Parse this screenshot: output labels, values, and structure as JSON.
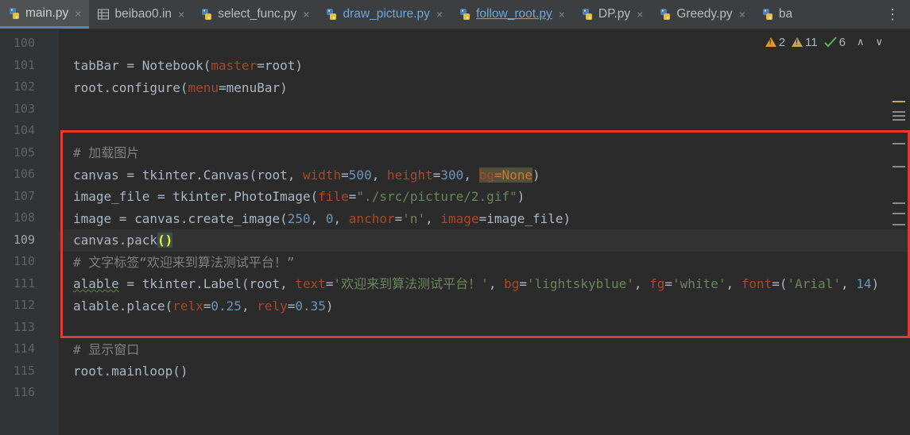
{
  "tabs": [
    {
      "label": "main.py",
      "icon": "python-file-icon",
      "active": true,
      "closable": true,
      "style": "normal"
    },
    {
      "label": "beibao0.in",
      "icon": "text-file-icon",
      "active": false,
      "closable": true,
      "style": "normal"
    },
    {
      "label": "select_func.py",
      "icon": "python-file-icon",
      "active": false,
      "closable": true,
      "style": "normal"
    },
    {
      "label": "draw_picture.py",
      "icon": "python-file-icon",
      "active": false,
      "closable": true,
      "style": "blue"
    },
    {
      "label": "follow_root.py",
      "icon": "python-file-icon",
      "active": false,
      "closable": true,
      "style": "blue-underline"
    },
    {
      "label": "DP.py",
      "icon": "python-file-icon",
      "active": false,
      "closable": true,
      "style": "normal"
    },
    {
      "label": "Greedy.py",
      "icon": "python-file-icon",
      "active": false,
      "closable": true,
      "style": "normal"
    },
    {
      "label": "ba",
      "icon": "python-file-icon",
      "active": false,
      "closable": false,
      "style": "normal"
    }
  ],
  "close_glyph": "×",
  "more_glyph": "⋮",
  "inspection": {
    "errors": "2",
    "warnings": "11",
    "ok": "6",
    "up_glyph": "∧",
    "down_glyph": "∨"
  },
  "line_numbers": [
    "100",
    "101",
    "102",
    "103",
    "104",
    "105",
    "106",
    "107",
    "108",
    "109",
    "110",
    "111",
    "112",
    "113",
    "114",
    "115",
    "116"
  ],
  "current_line": "109",
  "code": {
    "l101": {
      "a": "tabBar = Notebook(",
      "b": "master",
      "c": "=root)"
    },
    "l102": {
      "a": "root.configure(",
      "b": "menu",
      "c": "=menuBar)"
    },
    "l105": {
      "a": "# 加载图片"
    },
    "l106": {
      "a": "canvas = tkinter.Canvas(root, ",
      "b": "width",
      "c": "=",
      "d": "500",
      "e": ", ",
      "f": "height",
      "g": "=",
      "h": "300",
      "i": ", ",
      "j": "bg",
      "k": "=None",
      "l": ")"
    },
    "l107": {
      "a": "image_file = tkinter.PhotoImage(",
      "b": "file",
      "c": "=",
      "d": "\"./src/picture/2.gif\"",
      "e": ")"
    },
    "l108": {
      "a": "image = canvas.create_image(",
      "b": "250",
      "c": ", ",
      "d": "0",
      "e": ", ",
      "f": "anchor",
      "g": "=",
      "h": "'n'",
      "i": ", ",
      "j": "image",
      "k": "=image_file)"
    },
    "l109": {
      "a": "canvas.pack",
      "b": "()"
    },
    "l110": {
      "a": "# 文字标签“欢迎来到算法测试平台！”"
    },
    "l111": {
      "a": "alable",
      "b": " = tkinter.Label(root, ",
      "c": "text",
      "d": "=",
      "e": "'欢迎来到算法测试平台！'",
      "f": ", ",
      "g": "bg",
      "h": "=",
      "i": "'lightskyblue'",
      "j": ", ",
      "k": "fg",
      "l": "=",
      "m": "'white'",
      "n": ", ",
      "o": "font",
      "p": "=(",
      "q": "'Arial'",
      "r": ", ",
      "s": "14",
      "t": ")"
    },
    "l112": {
      "a": "alable",
      "b": ".place(",
      "c": "relx",
      "d": "=",
      "e": "0.25",
      "f": ", ",
      "g": "rely",
      "h": "=",
      "i": "0.35",
      "j": ")"
    },
    "l114": {
      "a": "# 显示窗口"
    },
    "l115": {
      "a": "root.mainloop()"
    }
  },
  "colors": {
    "background": "#2b2b2b",
    "highlight_box": "#e53935",
    "keyword_param": "#aa4926",
    "string": "#6a8759",
    "number": "#6897bb",
    "comment": "#808080"
  }
}
